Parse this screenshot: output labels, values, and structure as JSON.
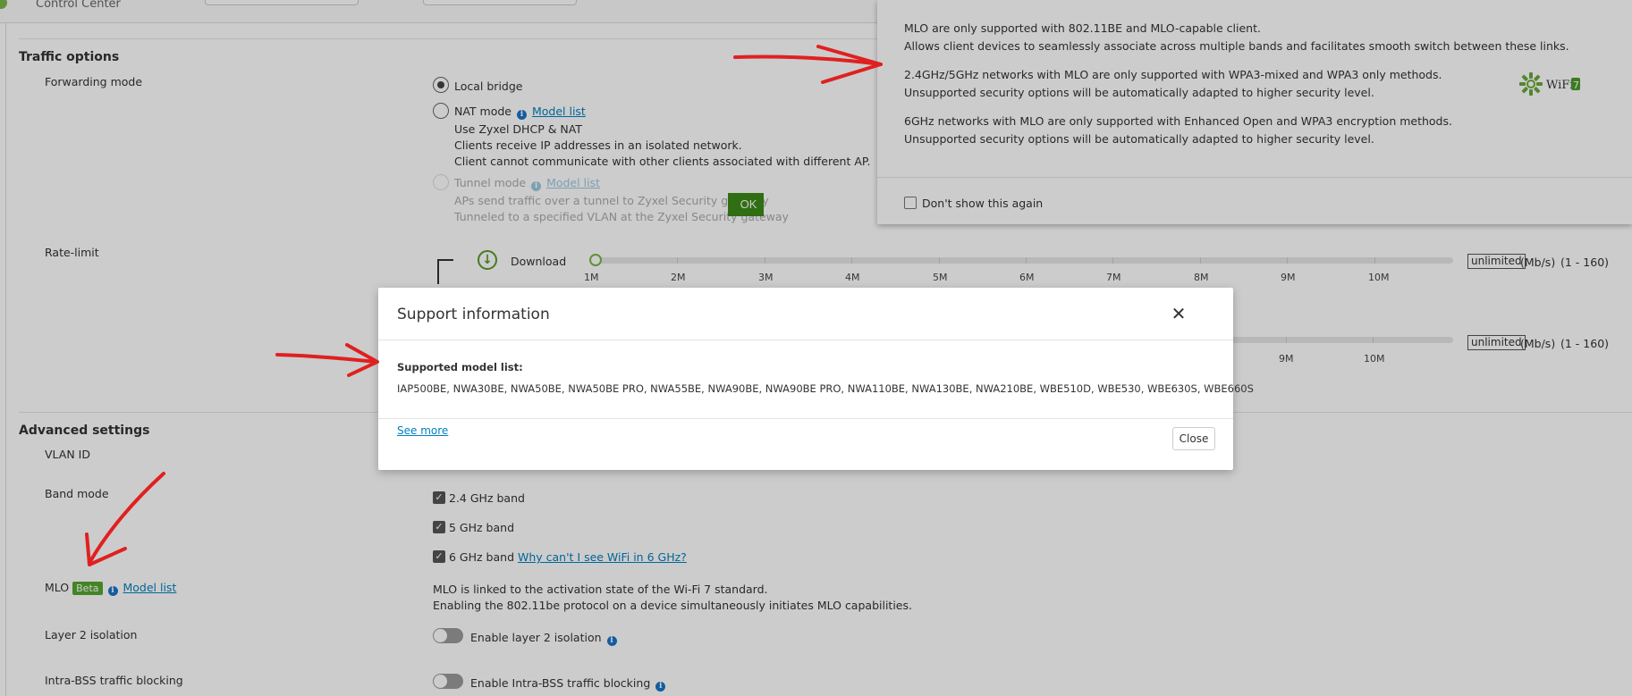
{
  "app": {
    "title": "Control Center"
  },
  "traffic": {
    "section_title": "Traffic options",
    "forwarding_label": "Forwarding mode",
    "local_bridge": "Local bridge",
    "nat_mode": "NAT mode",
    "nat_model_list": "Model list",
    "nat_desc": [
      "Use Zyxel DHCP & NAT",
      "Clients receive IP addresses in an isolated network.",
      "Client cannot communicate with other clients associated with different AP."
    ],
    "tunnel_mode": "Tunnel mode",
    "tunnel_model_list": "Model list",
    "tunnel_desc": [
      "APs send traffic over a tunnel to Zyxel Security gateway",
      "Tunneled to a specified VLAN at the Zyxel Security gateway"
    ],
    "rate_limit_label": "Rate-limit",
    "download_label": "Download",
    "download_value_fraction": 0.0,
    "ticks": [
      "1M",
      "2M",
      "3M",
      "4M",
      "5M",
      "6M",
      "7M",
      "8M",
      "9M",
      "10M"
    ],
    "upload_ticks": [
      "9M",
      "10M"
    ],
    "unlimited": "unlimited",
    "unit": "(Mb/s)",
    "range": "(1 - 160)"
  },
  "advanced": {
    "section_title": "Advanced settings",
    "vlan_label": "VLAN ID",
    "band_label": "Band mode",
    "band_24": "2.4 GHz band",
    "band_5": "5 GHz band",
    "band_6": "6 GHz band",
    "band_6_link": "Why can't I see WiFi in 6 GHz?",
    "mlo_label": "MLO",
    "mlo_badge": "Beta",
    "mlo_model_list": "Model list",
    "mlo_desc": [
      "MLO is linked to the activation state of the Wi-Fi 7 standard.",
      "Enabling the 802.11be protocol on a device simultaneously initiates MLO capabilities."
    ],
    "l2_label": "Layer 2 isolation",
    "l2_toggle": "Enable layer 2 isolation",
    "intra_label": "Intra-BSS traffic blocking",
    "intra_toggle": "Enable Intra-BSS traffic blocking"
  },
  "mlo_popup": {
    "lines": [
      "MLO are only supported with 802.11BE and MLO-capable client.",
      "Allows client devices to seamlessly associate across multiple bands and facilitates smooth switch between these links.",
      "2.4GHz/5GHz networks with MLO are only supported with WPA3-mixed and WPA3 only methods.",
      "Unsupported security options will be automatically adapted to higher security level.",
      "6GHz networks with MLO are only supported with Enhanced Open and WPA3 encryption methods.",
      "Unsupported security options will be automatically adapted to higher security level."
    ],
    "dont_show": "Don't show this again",
    "ok": "OK",
    "wifi_logo_text": "WiFi",
    "wifi_logo_num": "7"
  },
  "modal": {
    "title": "Support information",
    "list_label": "Supported model list:",
    "models": "IAP500BE, NWA30BE, NWA50BE, NWA50BE PRO, NWA55BE, NWA90BE, NWA90BE PRO, NWA110BE, NWA130BE, NWA210BE, WBE510D, WBE530, WBE630S, WBE660S",
    "see_more": "See more",
    "close": "Close"
  },
  "colors": {
    "accent": "#56a630",
    "link": "#0080c0",
    "annotation": "#e02020"
  },
  "icons": [
    "close-icon",
    "info-icon",
    "download-icon",
    "checkmark-icon",
    "wifi7-logo"
  ]
}
